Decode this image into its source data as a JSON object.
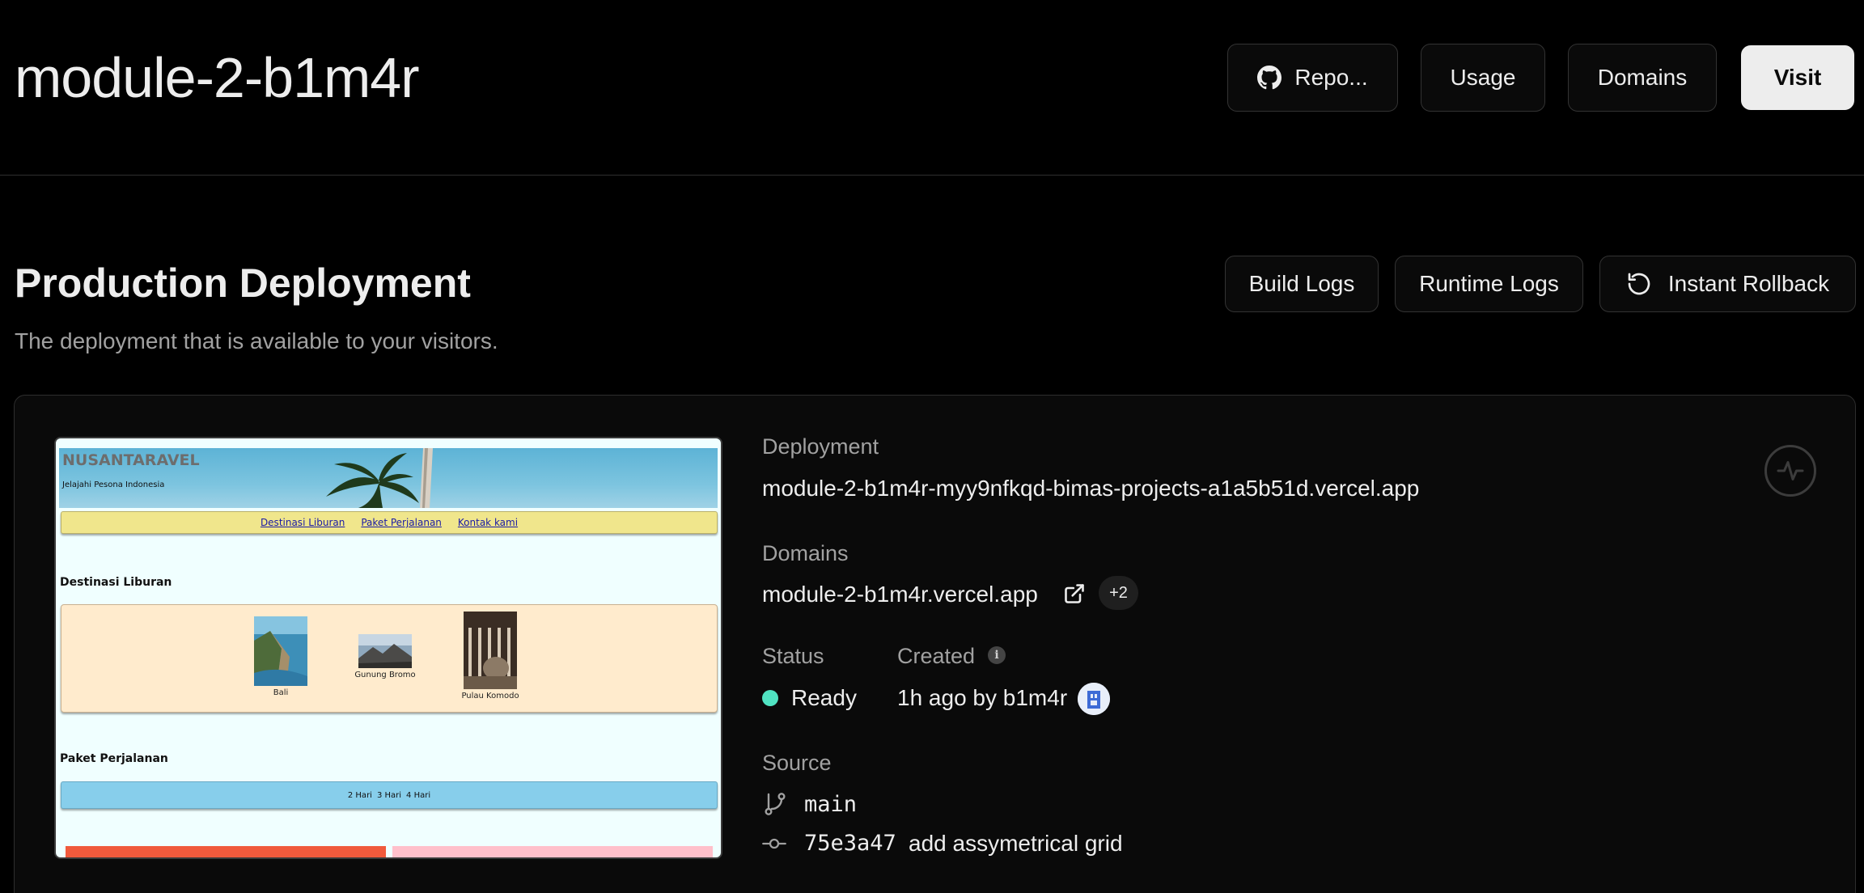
{
  "header": {
    "project_name": "module-2-b1m4r",
    "repo_label": "Repo...",
    "usage_label": "Usage",
    "domains_label": "Domains",
    "visit_label": "Visit"
  },
  "section": {
    "title": "Production Deployment",
    "subtitle": "The deployment that is available to your visitors.",
    "build_logs_label": "Build Logs",
    "runtime_logs_label": "Runtime Logs",
    "rollback_label": "Instant Rollback"
  },
  "preview": {
    "brand": "NUSANTARAVEL",
    "tagline": "Jelajahi Pesona Indonesia",
    "nav": [
      "Destinasi Liburan",
      "Paket Perjalanan",
      "Kontak kami"
    ],
    "section1_heading": "Destinasi Liburan",
    "destinations": [
      "Bali",
      "Gunung Bromo",
      "Pulau Komodo"
    ],
    "section2_heading": "Paket Perjalanan",
    "packages": [
      "2 Hari",
      "3 Hari",
      "4 Hari"
    ]
  },
  "details": {
    "deployment_label": "Deployment",
    "deployment_url": "module-2-b1m4r-myy9nfkqd-bimas-projects-a1a5b51d.vercel.app",
    "domains_label": "Domains",
    "domain": "module-2-b1m4r.vercel.app",
    "domain_extra": "+2",
    "status_label": "Status",
    "status_value": "Ready",
    "created_label": "Created",
    "created_value": "1h ago by b1m4r",
    "source_label": "Source",
    "branch": "main",
    "commit_hash": "75e3a47",
    "commit_message": "add assymetrical grid"
  },
  "colors": {
    "background": "#000000",
    "status_ready": "#50e3c2",
    "visit_button_bg": "#ededed"
  }
}
